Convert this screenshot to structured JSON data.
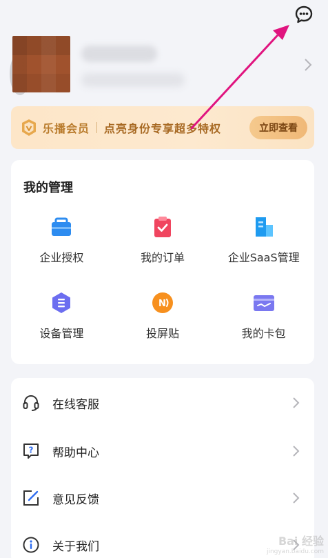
{
  "header": {
    "message_icon": "chat-bubble-icon"
  },
  "profile": {
    "chevron_icon": "chevron-right-icon"
  },
  "vip_banner": {
    "name": "乐播会员",
    "text": "点亮身份专享超多特权",
    "button_label": "立即查看",
    "icon": "shield-badge-icon"
  },
  "management": {
    "title": "我的管理",
    "items": [
      {
        "label": "企业授权",
        "icon": "briefcase-icon",
        "color": "#2d8cf0"
      },
      {
        "label": "我的订单",
        "icon": "order-check-icon",
        "color": "#f0455f"
      },
      {
        "label": "企业SaaS管理",
        "icon": "building-icon",
        "color": "#1e9bf0"
      },
      {
        "label": "设备管理",
        "icon": "hexagon-device-icon",
        "color": "#6c6ef0"
      },
      {
        "label": "投屏贴",
        "icon": "cast-sticker-icon",
        "color": "#f7901e"
      },
      {
        "label": "我的卡包",
        "icon": "card-wallet-icon",
        "color": "#7a78f0"
      }
    ]
  },
  "menu": {
    "items": [
      {
        "label": "在线客服",
        "icon": "headset-icon"
      },
      {
        "label": "帮助中心",
        "icon": "help-question-icon"
      },
      {
        "label": "意见反馈",
        "icon": "edit-feedback-icon"
      },
      {
        "label": "关于我们",
        "icon": "info-icon"
      }
    ]
  },
  "watermark": {
    "title": "Bai 经验",
    "url": "jingyan.baidu.com"
  },
  "colors": {
    "annotation_arrow": "#e0147f",
    "vip_text": "#b97b2c",
    "background": "#f3f4f8"
  }
}
